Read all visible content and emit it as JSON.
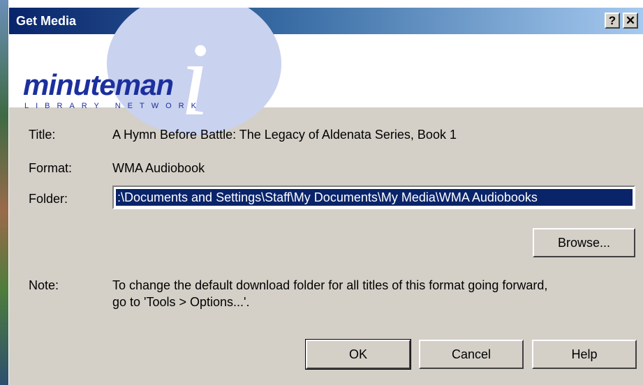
{
  "window": {
    "title": "Get Media",
    "help_button": "?",
    "close_button": "✕"
  },
  "logo": {
    "name": "minuteman",
    "subtitle": "LIBRARY NETWORK"
  },
  "fields": {
    "title_label": "Title:",
    "title_value": "A Hymn Before Battle: The Legacy of Aldenata Series, Book 1",
    "format_label": "Format:",
    "format_value": "WMA Audiobook",
    "folder_label": "Folder:",
    "folder_value": ":\\Documents and Settings\\Staff\\My Documents\\My Media\\WMA Audiobooks"
  },
  "browse_label": "Browse...",
  "note": {
    "label": "Note:",
    "line1": "To change the default download folder for all titles of this format going forward,",
    "line2": "go to 'Tools > Options...'."
  },
  "buttons": {
    "ok": "OK",
    "cancel": "Cancel",
    "help": "Help"
  }
}
